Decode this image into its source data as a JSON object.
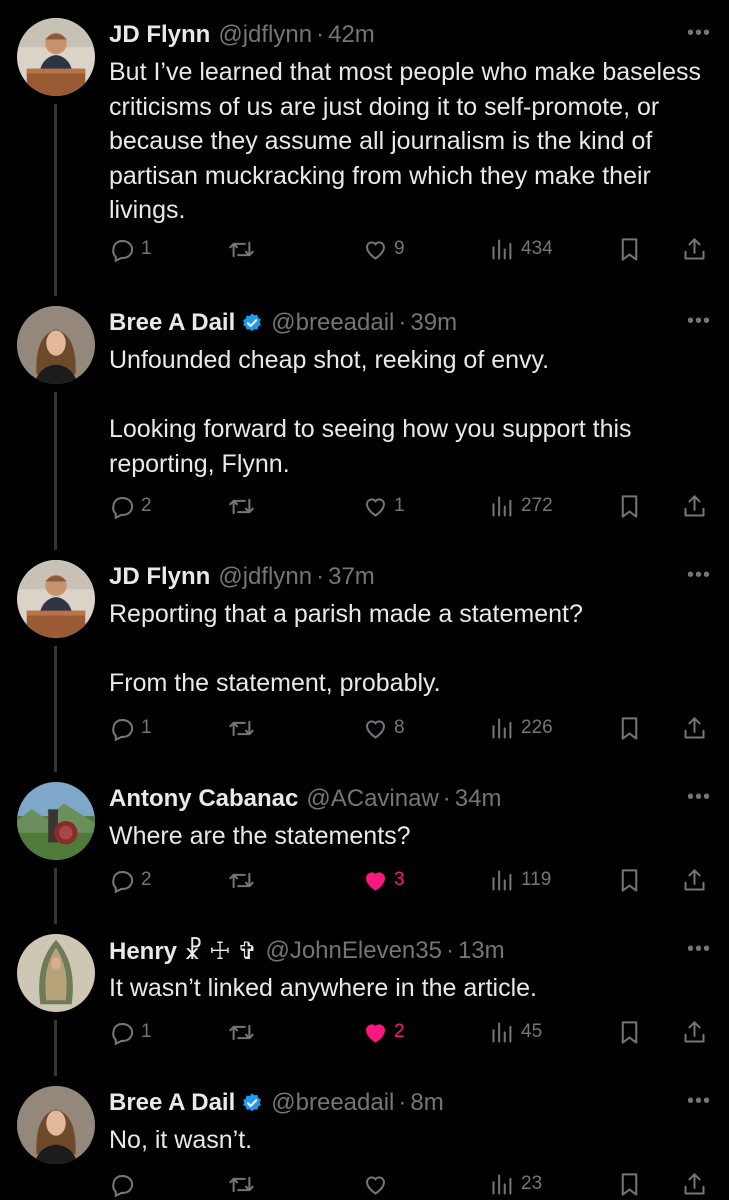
{
  "tweets": [
    {
      "name": "JD Flynn",
      "handle": "@jdflynn",
      "time": "42m",
      "verified": false,
      "avatar": "jd",
      "text": "But I’ve learned that most people who make baseless criticisms of us are just doing it to self-promote, or because they assume all journalism is the kind of partisan muckracking from which they make their livings.",
      "replies": "1",
      "retweets": "",
      "likes": "9",
      "liked": false,
      "views": "434"
    },
    {
      "name": "Bree A Dail",
      "handle": "@breeadail",
      "time": "39m",
      "verified": true,
      "avatar": "bree",
      "text": "Unfounded cheap shot, reeking of envy.\n\nLooking forward to seeing how you support this reporting, Flynn.",
      "replies": "2",
      "retweets": "",
      "likes": "1",
      "liked": false,
      "views": "272"
    },
    {
      "name": "JD Flynn",
      "handle": "@jdflynn",
      "time": "37m",
      "verified": false,
      "avatar": "jd",
      "text": "Reporting that a parish made a statement?\n\nFrom the statement, probably.",
      "replies": "1",
      "retweets": "",
      "likes": "8",
      "liked": false,
      "views": "226"
    },
    {
      "name": "Antony Cabanac",
      "handle": "@ACavinaw",
      "time": "34m",
      "verified": false,
      "avatar": "antony",
      "text": "Where are the statements?",
      "replies": "2",
      "retweets": "",
      "likes": "3",
      "liked": true,
      "views": "119"
    },
    {
      "name": "Henry ☧ ☩ ✞",
      "handle": "@JohnEleven35",
      "time": "13m",
      "verified": false,
      "avatar": "henry",
      "text": "It wasn’t linked anywhere in the article.",
      "replies": "1",
      "retweets": "",
      "likes": "2",
      "liked": true,
      "views": "45"
    },
    {
      "name": "Bree A Dail",
      "handle": "@breeadail",
      "time": "8m",
      "verified": true,
      "avatar": "bree",
      "text": "No, it wasn’t.",
      "replies": "",
      "retweets": "",
      "likes": "",
      "liked": false,
      "views": "23"
    }
  ],
  "colors": {
    "background": "#000000",
    "text": "#e7e9ea",
    "muted": "#71767b",
    "verified": "#1d9bf0",
    "like": "#f91880",
    "thread_line": "#333639"
  },
  "icons": [
    "reply-icon",
    "retweet-icon",
    "like-icon",
    "views-icon",
    "bookmark-icon",
    "share-icon",
    "more-icon",
    "verified-badge-icon"
  ]
}
